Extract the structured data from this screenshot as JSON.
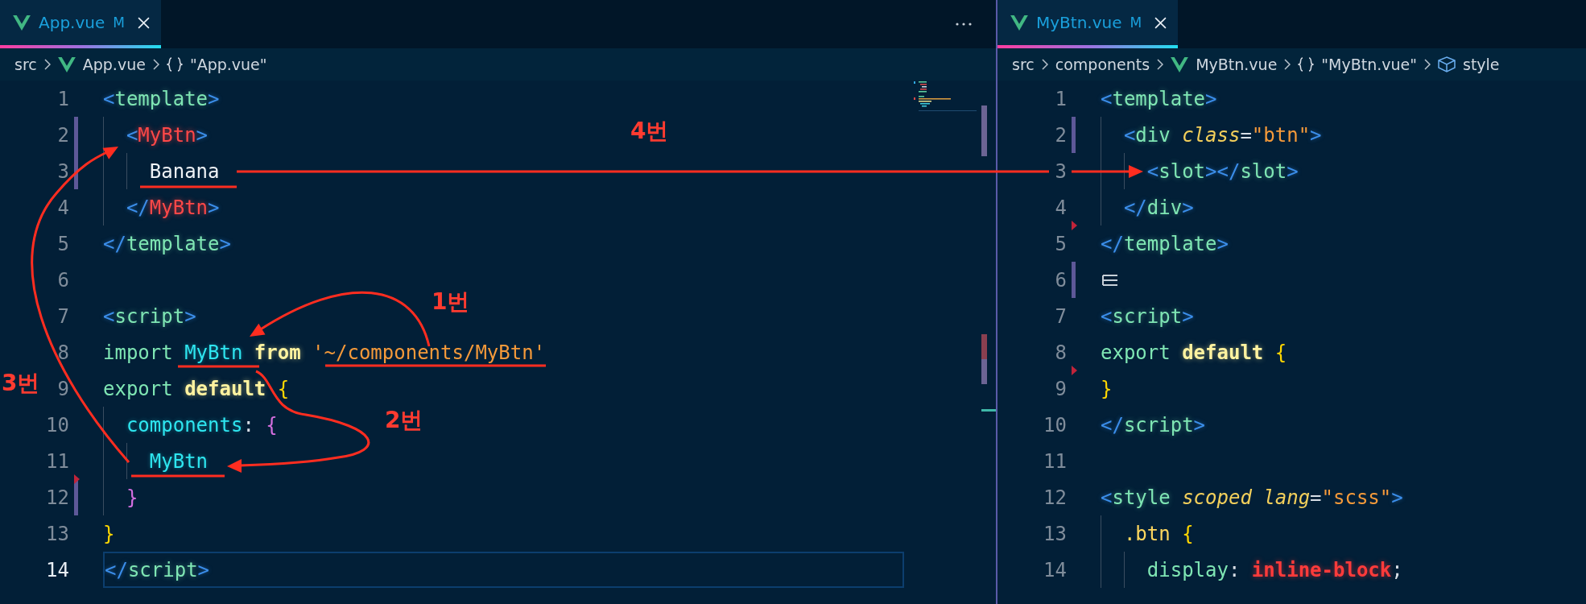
{
  "panes": [
    {
      "tab": {
        "label": "App.vue",
        "badge": "M",
        "selected": true
      },
      "more_button": true,
      "minimap": true,
      "breadcrumbs": [
        {
          "text": "src",
          "kind": "folder"
        },
        {
          "text": "App.vue",
          "kind": "file"
        },
        {
          "text": "\"App.vue\"",
          "kind": "symbol"
        }
      ],
      "lines": [
        {
          "number": "1",
          "modified": false,
          "deleted_above": false,
          "current": false,
          "tokens": [
            {
              "kind": "bracket",
              "text": "<"
            },
            {
              "kind": "tag",
              "text": "template"
            },
            {
              "kind": "bracket",
              "text": ">"
            }
          ]
        },
        {
          "number": "2",
          "modified": true,
          "deleted_above": false,
          "current": false,
          "tokens": [
            {
              "kind": "bracket",
              "text": "  <"
            },
            {
              "kind": "component",
              "text": "MyBtn"
            },
            {
              "kind": "bracket",
              "text": ">"
            }
          ]
        },
        {
          "number": "3",
          "modified": true,
          "deleted_above": false,
          "current": false,
          "tokens": [
            {
              "kind": "text",
              "text": "    Banana"
            }
          ]
        },
        {
          "number": "4",
          "modified": false,
          "deleted_above": false,
          "current": false,
          "tokens": [
            {
              "kind": "bracket",
              "text": "  </"
            },
            {
              "kind": "component",
              "text": "MyBtn"
            },
            {
              "kind": "bracket",
              "text": ">"
            }
          ]
        },
        {
          "number": "5",
          "modified": false,
          "deleted_above": false,
          "current": false,
          "tokens": [
            {
              "kind": "bracket",
              "text": "</"
            },
            {
              "kind": "tag",
              "text": "template"
            },
            {
              "kind": "bracket",
              "text": ">"
            }
          ]
        },
        {
          "number": "6",
          "modified": false,
          "deleted_above": false,
          "current": false
        },
        {
          "number": "7",
          "modified": false,
          "deleted_above": false,
          "current": false,
          "tokens": [
            {
              "kind": "bracket",
              "text": "<"
            },
            {
              "kind": "tag",
              "text": "script"
            },
            {
              "kind": "bracket",
              "text": ">"
            }
          ]
        },
        {
          "number": "8",
          "modified": false,
          "deleted_above": false,
          "current": false,
          "tokens": [
            {
              "kind": "keyword",
              "text": "import"
            },
            {
              "kind": "identifier",
              "text": " MyBtn"
            },
            {
              "kind": "strong",
              "text": " from"
            },
            {
              "kind": "string",
              "text": " '~/components/MyBtn'"
            }
          ]
        },
        {
          "number": "9",
          "modified": false,
          "deleted_above": false,
          "current": false,
          "tokens": [
            {
              "kind": "keyword",
              "text": "export"
            },
            {
              "kind": "strong",
              "text": " default"
            },
            {
              "kind": "brace",
              "text": " {"
            }
          ]
        },
        {
          "number": "10",
          "modified": false,
          "deleted_above": false,
          "current": false,
          "tokens": [
            {
              "kind": "identifier",
              "text": "  components"
            },
            {
              "kind": "punct",
              "text": ":"
            },
            {
              "kind": "brace2",
              "text": " {"
            }
          ]
        },
        {
          "number": "11",
          "modified": false,
          "deleted_above": false,
          "current": false,
          "tokens": [
            {
              "kind": "identifier",
              "text": "    MyBtn"
            }
          ]
        },
        {
          "number": "12",
          "modified": true,
          "deleted_above": true,
          "current": false,
          "tokens": [
            {
              "kind": "brace2",
              "text": "  }"
            }
          ]
        },
        {
          "number": "13",
          "modified": false,
          "deleted_above": false,
          "current": false,
          "tokens": [
            {
              "kind": "brace",
              "text": "}"
            }
          ]
        },
        {
          "number": "14",
          "modified": false,
          "deleted_above": false,
          "current": true,
          "tokens": [
            {
              "kind": "bracket",
              "text": "</"
            },
            {
              "kind": "tag",
              "text": "script"
            },
            {
              "kind": "bracket",
              "text": ">"
            }
          ]
        }
      ]
    },
    {
      "tab": {
        "label": "MyBtn.vue",
        "badge": "M",
        "selected": true
      },
      "more_button": false,
      "minimap": false,
      "breadcrumbs": [
        {
          "text": "src",
          "kind": "folder"
        },
        {
          "text": "components",
          "kind": "folder"
        },
        {
          "text": "MyBtn.vue",
          "kind": "file"
        },
        {
          "text": "\"MyBtn.vue\"",
          "kind": "symbol"
        },
        {
          "text": "style",
          "kind": "element"
        }
      ],
      "lines": [
        {
          "number": "1",
          "modified": false,
          "deleted_above": false,
          "current": false,
          "tokens": [
            {
              "kind": "bracket",
              "text": "<"
            },
            {
              "kind": "tag",
              "text": "template"
            },
            {
              "kind": "bracket",
              "text": ">"
            }
          ]
        },
        {
          "number": "2",
          "modified": true,
          "deleted_above": false,
          "current": false,
          "tokens": [
            {
              "kind": "bracket",
              "text": "  <"
            },
            {
              "kind": "tag",
              "text": "div"
            },
            {
              "kind": "attr",
              "text": " class"
            },
            {
              "kind": "punct",
              "text": "="
            },
            {
              "kind": "string",
              "text": "\"btn\""
            },
            {
              "kind": "bracket",
              "text": ">"
            }
          ]
        },
        {
          "number": "3",
          "modified": false,
          "deleted_above": false,
          "current": false,
          "tokens": [
            {
              "kind": "bracket",
              "text": "    <"
            },
            {
              "kind": "tag",
              "text": "slot"
            },
            {
              "kind": "bracket",
              "text": "></"
            },
            {
              "kind": "tag",
              "text": "slot"
            },
            {
              "kind": "bracket",
              "text": ">"
            }
          ]
        },
        {
          "number": "4",
          "modified": false,
          "deleted_above": false,
          "current": false,
          "tokens": [
            {
              "kind": "bracket",
              "text": "  </"
            },
            {
              "kind": "tag",
              "text": "div"
            },
            {
              "kind": "bracket",
              "text": ">"
            }
          ]
        },
        {
          "number": "5",
          "modified": false,
          "deleted_above": true,
          "current": false,
          "tokens": [
            {
              "kind": "bracket",
              "text": "</"
            },
            {
              "kind": "tag",
              "text": "template"
            },
            {
              "kind": "bracket",
              "text": ">"
            }
          ]
        },
        {
          "number": "6",
          "modified": true,
          "deleted_above": false,
          "current": false,
          "tokens": [
            {
              "kind": "icon"
            }
          ]
        },
        {
          "number": "7",
          "modified": false,
          "deleted_above": false,
          "current": false,
          "tokens": [
            {
              "kind": "bracket",
              "text": "<"
            },
            {
              "kind": "tag",
              "text": "script"
            },
            {
              "kind": "bracket",
              "text": ">"
            }
          ]
        },
        {
          "number": "8",
          "modified": false,
          "deleted_above": false,
          "current": false,
          "tokens": [
            {
              "kind": "keyword",
              "text": "export"
            },
            {
              "kind": "strong",
              "text": " default"
            },
            {
              "kind": "brace",
              "text": " {"
            }
          ]
        },
        {
          "number": "9",
          "modified": false,
          "deleted_above": true,
          "current": false,
          "tokens": [
            {
              "kind": "brace",
              "text": "}"
            }
          ]
        },
        {
          "number": "10",
          "modified": false,
          "deleted_above": false,
          "current": false,
          "tokens": [
            {
              "kind": "bracket",
              "text": "</"
            },
            {
              "kind": "tag",
              "text": "script"
            },
            {
              "kind": "bracket",
              "text": ">"
            }
          ]
        },
        {
          "number": "11",
          "modified": false,
          "deleted_above": false,
          "current": false
        },
        {
          "number": "12",
          "modified": false,
          "deleted_above": false,
          "current": false,
          "tokens": [
            {
              "kind": "bracket",
              "text": "<"
            },
            {
              "kind": "tag",
              "text": "style"
            },
            {
              "kind": "attr",
              "text": " scoped"
            },
            {
              "kind": "attr",
              "text": " lang"
            },
            {
              "kind": "punct",
              "text": "="
            },
            {
              "kind": "string",
              "text": "\"scss\""
            },
            {
              "kind": "bracket",
              "text": ">"
            }
          ]
        },
        {
          "number": "13",
          "modified": false,
          "deleted_above": false,
          "current": false,
          "tokens": [
            {
              "kind": "selector",
              "text": "  .btn"
            },
            {
              "kind": "brace",
              "text": " {"
            }
          ]
        },
        {
          "number": "14",
          "modified": false,
          "deleted_above": false,
          "current": false,
          "tokens": [
            {
              "kind": "keyword",
              "text": "    display"
            },
            {
              "kind": "punct",
              "text": ":"
            },
            {
              "kind": "value",
              "text": " inline-block"
            },
            {
              "kind": "punct",
              "text": ";"
            }
          ]
        }
      ]
    }
  ],
  "annotations": [
    {
      "label": "1번"
    },
    {
      "label": "2번"
    },
    {
      "label": "3번"
    },
    {
      "label": "4번"
    }
  ]
}
